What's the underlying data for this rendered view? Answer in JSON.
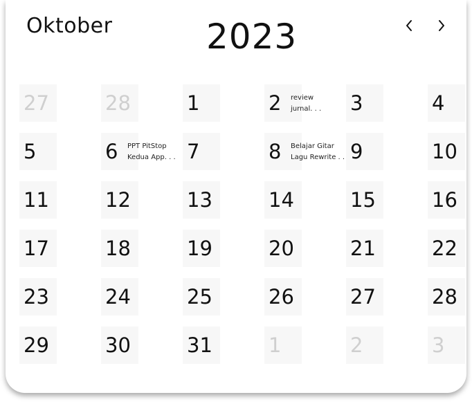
{
  "header": {
    "month": "Oktober",
    "year": "2023"
  },
  "nav": {
    "prev_icon": "chevron-left-icon",
    "next_icon": "chevron-right-icon"
  },
  "calendar": {
    "weeks": [
      [
        {
          "day": "27",
          "muted": true,
          "event": ""
        },
        {
          "day": "28",
          "muted": true,
          "event": ""
        },
        {
          "day": "1",
          "muted": false,
          "event": ""
        },
        {
          "day": "2",
          "muted": false,
          "event": "review\njurnal. . ."
        },
        {
          "day": "3",
          "muted": false,
          "event": ""
        },
        {
          "day": "4",
          "muted": false,
          "event": ""
        }
      ],
      [
        {
          "day": "5",
          "muted": false,
          "event": ""
        },
        {
          "day": "6",
          "muted": false,
          "event": "PPT PitStop\nKedua App. . ."
        },
        {
          "day": "7",
          "muted": false,
          "event": ""
        },
        {
          "day": "8",
          "muted": false,
          "event": "Belajar Gitar\nLagu Rewrite . . ."
        },
        {
          "day": "9",
          "muted": false,
          "event": ""
        },
        {
          "day": "10",
          "muted": false,
          "event": ""
        }
      ],
      [
        {
          "day": "11",
          "muted": false,
          "event": ""
        },
        {
          "day": "12",
          "muted": false,
          "event": ""
        },
        {
          "day": "13",
          "muted": false,
          "event": ""
        },
        {
          "day": "14",
          "muted": false,
          "event": ""
        },
        {
          "day": "15",
          "muted": false,
          "event": ""
        },
        {
          "day": "16",
          "muted": false,
          "event": ""
        }
      ],
      [
        {
          "day": "17",
          "muted": false,
          "event": ""
        },
        {
          "day": "18",
          "muted": false,
          "event": ""
        },
        {
          "day": "19",
          "muted": false,
          "event": ""
        },
        {
          "day": "20",
          "muted": false,
          "event": ""
        },
        {
          "day": "21",
          "muted": false,
          "event": ""
        },
        {
          "day": "22",
          "muted": false,
          "event": ""
        }
      ],
      [
        {
          "day": "23",
          "muted": false,
          "event": ""
        },
        {
          "day": "24",
          "muted": false,
          "event": ""
        },
        {
          "day": "25",
          "muted": false,
          "event": ""
        },
        {
          "day": "26",
          "muted": false,
          "event": ""
        },
        {
          "day": "27",
          "muted": false,
          "event": ""
        },
        {
          "day": "28",
          "muted": false,
          "event": ""
        }
      ],
      [
        {
          "day": "29",
          "muted": false,
          "event": ""
        },
        {
          "day": "30",
          "muted": false,
          "event": ""
        },
        {
          "day": "31",
          "muted": false,
          "event": ""
        },
        {
          "day": "1",
          "muted": true,
          "event": ""
        },
        {
          "day": "2",
          "muted": true,
          "event": ""
        },
        {
          "day": "3",
          "muted": true,
          "event": ""
        }
      ]
    ]
  },
  "colors": {
    "tile": "#f7f7f7",
    "text": "#111111",
    "muted_text": "#cfcfcf"
  }
}
